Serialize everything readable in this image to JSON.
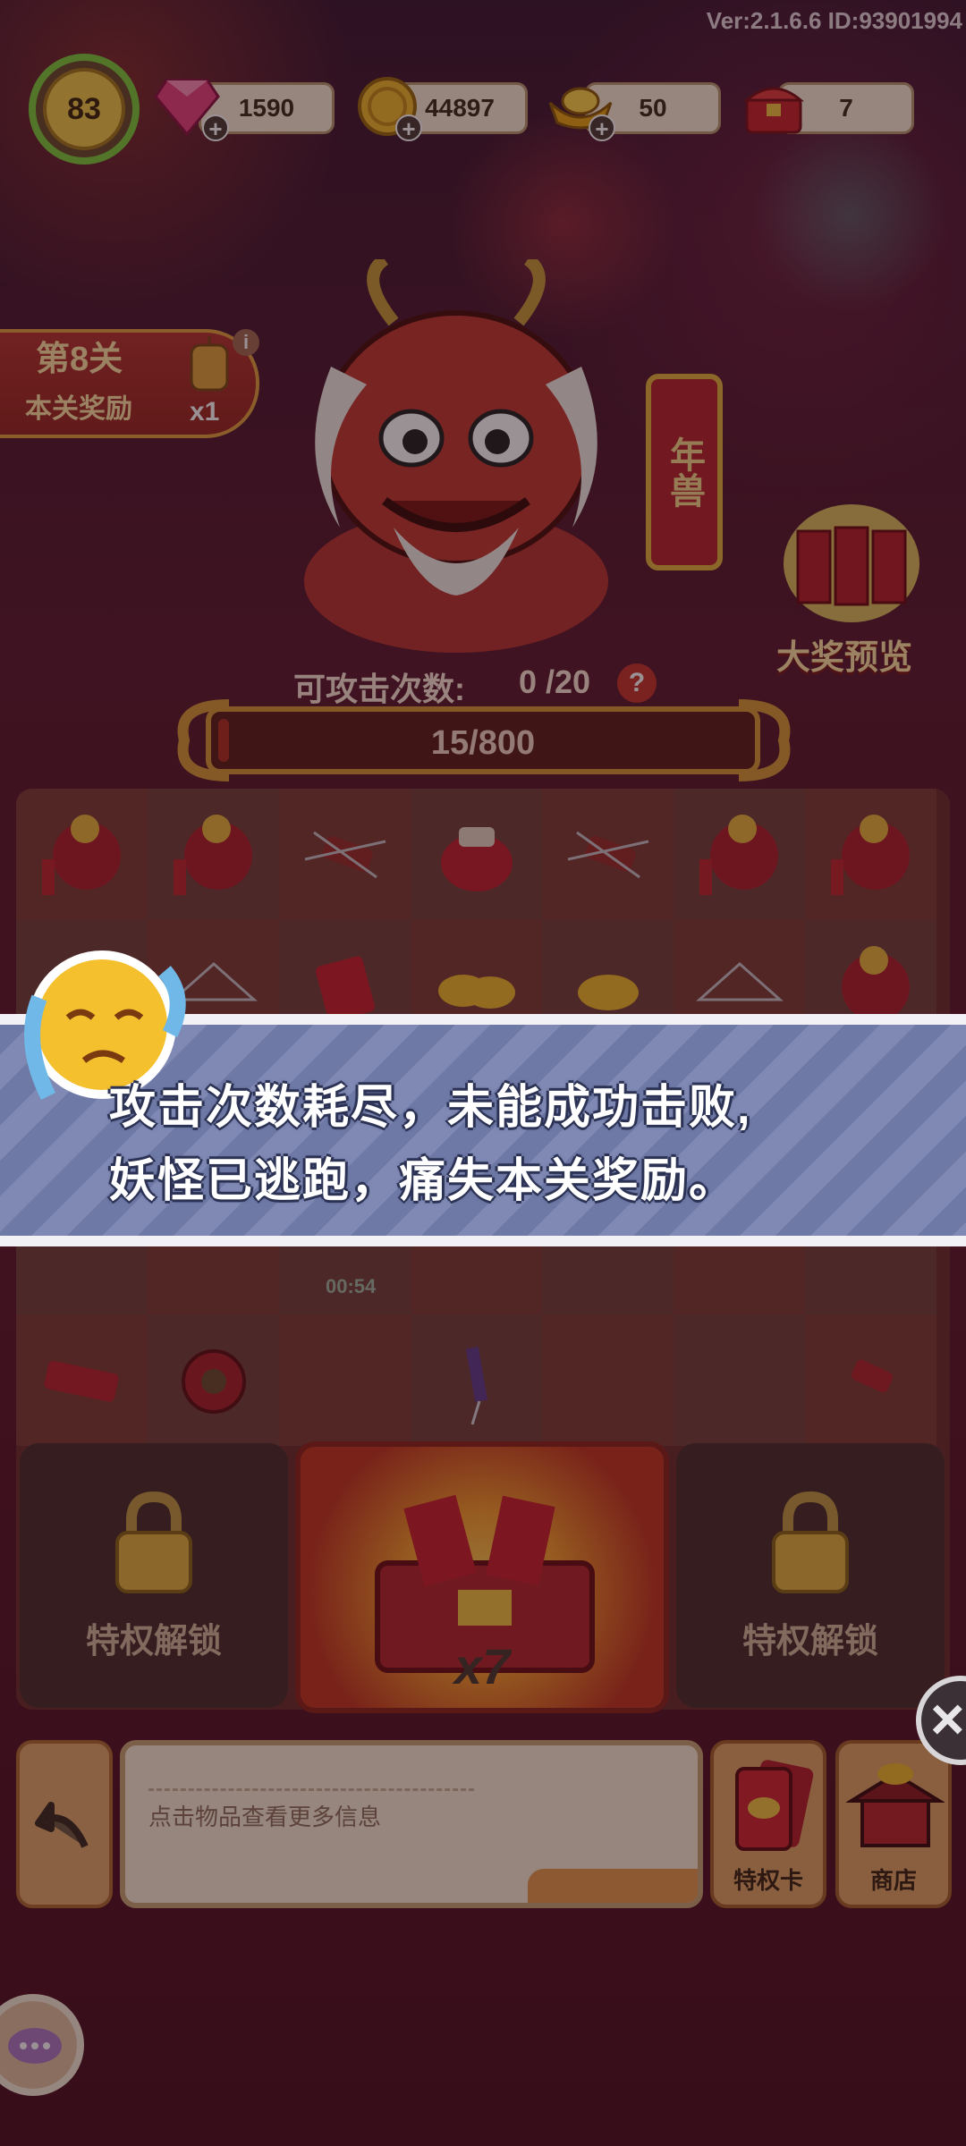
{
  "version": "Ver:2.1.6.6 ID:93901994",
  "player": {
    "level": "83"
  },
  "resources": [
    {
      "icon": "gem-icon",
      "value": "1590"
    },
    {
      "icon": "coin-icon",
      "value": "44897"
    },
    {
      "icon": "gold-ingot-icon",
      "value": "50"
    },
    {
      "icon": "treasure-chest-icon",
      "value": "7"
    }
  ],
  "level_panel": {
    "title": "第8关",
    "subtitle": "本关奖励",
    "reward_count": "x1",
    "info": "i"
  },
  "boss": {
    "name": "年兽",
    "prize_preview": "大奖预览"
  },
  "attack": {
    "label": "可攻击次数:",
    "value": "0 /20",
    "help": "?"
  },
  "hp": {
    "text": "15/800",
    "fraction": 0.019
  },
  "board": {
    "timer": "00:54"
  },
  "slots": {
    "left_label": "特权解锁",
    "right_label": "特权解锁",
    "chest_multiplier": "x7"
  },
  "bottom": {
    "info_text": "点击物品查看更多信息",
    "privilege_card_label": "特权卡",
    "shop_label": "商店"
  },
  "toast": {
    "line1": "攻击次数耗尽，未能成功击败,",
    "line2": "妖怪已逃跑，痛失本关奖励。"
  },
  "colors": {
    "accent": "#d79a36",
    "danger": "#b0301e",
    "toast": "#7f89b4"
  }
}
